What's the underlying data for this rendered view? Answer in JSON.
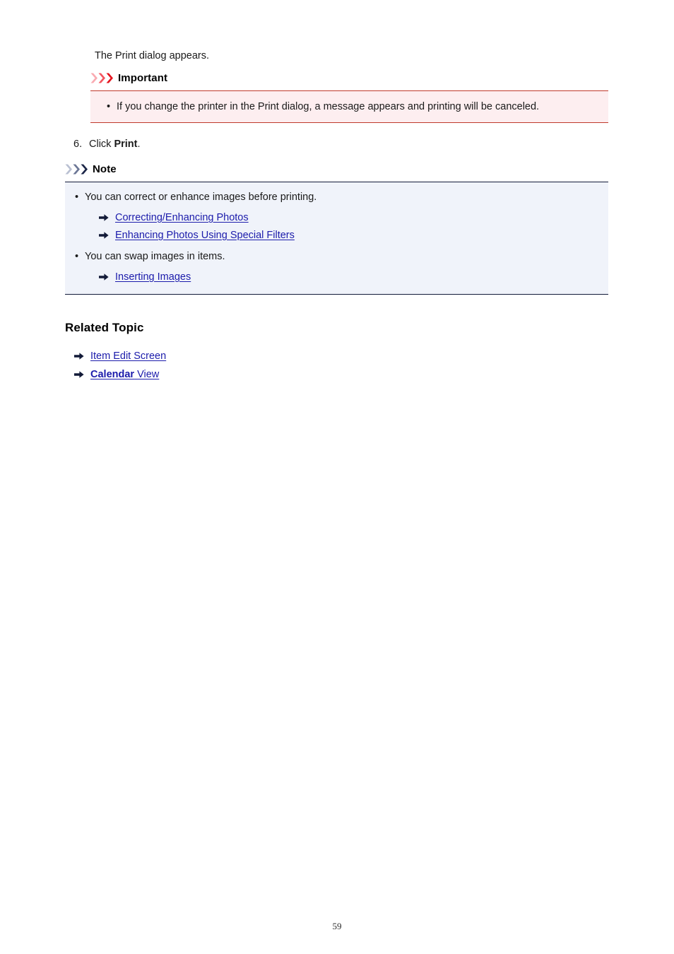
{
  "page": {
    "intro_text": "The Print dialog appears.",
    "page_number": "59"
  },
  "important": {
    "icon": "triple-chevron-icon",
    "title": "Important",
    "bullet_char": "•",
    "items": [
      "If you change the printer in the Print dialog, a message appears and printing will be canceled."
    ],
    "colors": {
      "background": "#fdeef0",
      "rule": "#c0392b",
      "chevron_light": "#f9aab1",
      "chevron_mid": "#f4545e",
      "chevron_dark": "#e4151f"
    }
  },
  "step": {
    "number": "6.",
    "prefix": "Click ",
    "bold_word": "Print",
    "suffix": "."
  },
  "note": {
    "icon": "triple-chevron-icon",
    "title": "Note",
    "bullet_char": "•",
    "bullets": [
      {
        "text": "You can correct or enhance images before printing.",
        "links": [
          {
            "icon": "arrow-right-icon",
            "label": "Correcting/Enhancing Photos"
          },
          {
            "icon": "arrow-right-icon",
            "label": "Enhancing Photos Using Special Filters"
          }
        ]
      },
      {
        "text": "You can swap images in items.",
        "links": [
          {
            "icon": "arrow-right-icon",
            "label": "Inserting Images"
          }
        ]
      }
    ],
    "colors": {
      "background": "#f0f3fa",
      "rule": "#121a38",
      "chevron_light": "#b9c0d2",
      "chevron_mid": "#6b7695",
      "chevron_dark": "#1b2547",
      "link": "#1b1bab"
    }
  },
  "related_topic": {
    "heading": "Related Topic",
    "links": [
      {
        "icon": "arrow-right-icon",
        "bold_part": "",
        "label": "Item Edit Screen"
      },
      {
        "icon": "arrow-right-icon",
        "bold_part": "Calendar",
        "label": " View"
      }
    ]
  }
}
